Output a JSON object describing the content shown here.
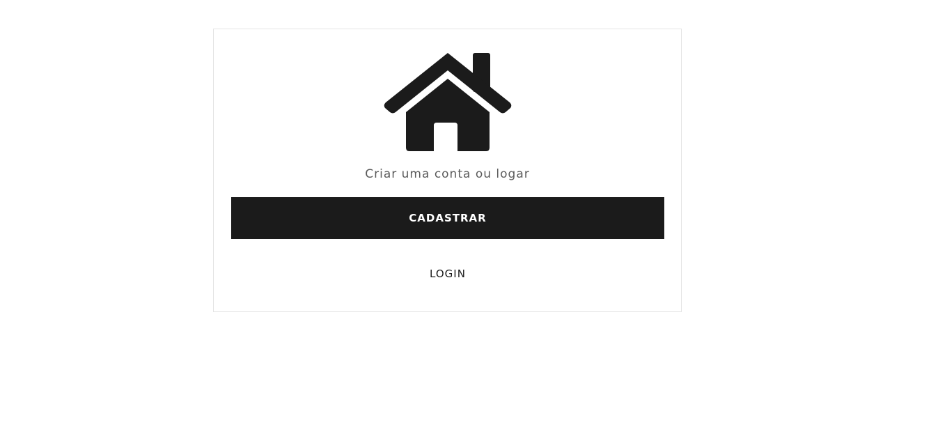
{
  "card": {
    "icon": "house-icon",
    "subtitle": "Criar uma conta ou logar",
    "register_label": "CADASTRAR",
    "login_label": "LOGIN"
  },
  "colors": {
    "primary": "#1b1b1b",
    "subtitle_text": "#5b5b5b",
    "card_border": "#e3e3e3",
    "background": "#ffffff"
  }
}
